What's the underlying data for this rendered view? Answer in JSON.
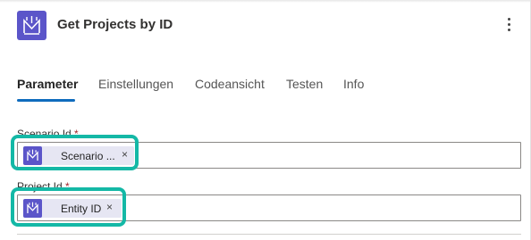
{
  "header": {
    "title": "Get Projects by ID",
    "icon": "connector-logo-icon",
    "more_icon": "more-vertical-icon"
  },
  "tabs": [
    {
      "label": "Parameter",
      "active": true
    },
    {
      "label": "Einstellungen",
      "active": false
    },
    {
      "label": "Codeansicht",
      "active": false
    },
    {
      "label": "Testen",
      "active": false
    },
    {
      "label": "Info",
      "active": false
    }
  ],
  "fields": {
    "scenario": {
      "label": "Scenario Id",
      "required_mark": "*",
      "token_label": "Scenario ...",
      "token_remove": "×"
    },
    "project": {
      "label": "Project Id",
      "required_mark": "*",
      "token_label": "Entity ID",
      "token_remove": "×"
    }
  },
  "colors": {
    "accent": "#0f6cbd",
    "connector": "#5b55c9",
    "highlight": "#14b8a6",
    "token_bg": "#e6e6f3"
  }
}
